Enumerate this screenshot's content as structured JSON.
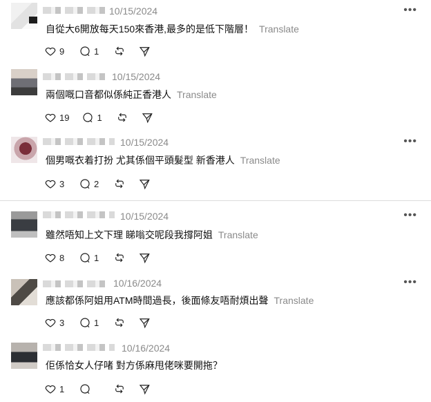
{
  "translate_label": "Translate",
  "posts": [
    {
      "date": "10/15/2024",
      "text": "自從大6開放每天150來香港,最多的是低下階層！",
      "likes": "9",
      "replies": "1"
    },
    {
      "date": "10/15/2024",
      "text": "兩個嘅口音都似係純正香港人",
      "likes": "19",
      "replies": "1"
    },
    {
      "date": "10/15/2024",
      "text": "個男嘅衣着打扮 尤其係個平頭髮型 新香港人",
      "likes": "3",
      "replies": "2"
    },
    {
      "date": "10/15/2024",
      "text": "雖然唔知上文下理 睇嗡交呢段我撐阿姐",
      "likes": "8",
      "replies": "1"
    },
    {
      "date": "10/16/2024",
      "text": "應該都係阿姐用ATM時間過長，後面條友唔耐煩出聲",
      "likes": "3",
      "replies": "1"
    },
    {
      "date": "10/16/2024",
      "text": "佢係恰女人仔啫 對方係麻甩佬咪要開拖？",
      "likes": "1",
      "replies": ""
    }
  ],
  "icons": {
    "like": "heart-icon",
    "reply": "comment-icon",
    "repost": "repost-icon",
    "share": "share-icon",
    "more": "more-icon"
  }
}
